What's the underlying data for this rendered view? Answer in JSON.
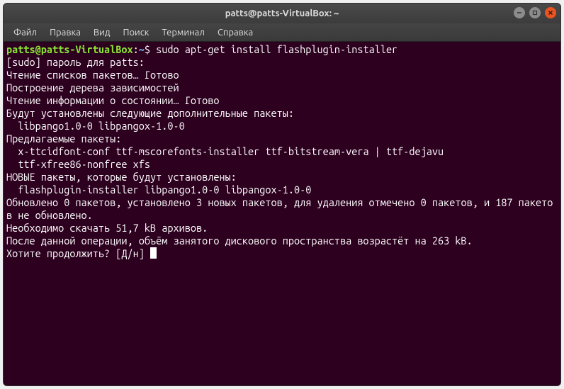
{
  "titlebar": {
    "title": "patts@patts-VirtualBox: ~"
  },
  "menubar": {
    "items": [
      "Файл",
      "Правка",
      "Вид",
      "Поиск",
      "Терминал",
      "Справка"
    ]
  },
  "terminal": {
    "prompt_user_host": "patts@patts-VirtualBox",
    "prompt_colon": ":",
    "prompt_path": "~",
    "prompt_dollar": "$ ",
    "command": "sudo apt-get install flashplugin-installer",
    "output_lines": [
      "[sudo] пароль для patts:",
      "Чтение списков пакетов… Готово",
      "Построение дерева зависимостей",
      "Чтение информации о состоянии… Готово",
      "Будут установлены следующие дополнительные пакеты:",
      "  libpango1.0-0 libpangox-1.0-0",
      "Предлагаемые пакеты:",
      "  x-ttcidfont-conf ttf-mscorefonts-installer ttf-bitstream-vera | ttf-dejavu",
      "  ttf-xfree86-nonfree xfs",
      "НОВЫЕ пакеты, которые будут установлены:",
      "  flashplugin-installer libpango1.0-0 libpangox-1.0-0",
      "Обновлено 0 пакетов, установлено 3 новых пакетов, для удаления отмечено 0 пакетов, и 187 пакетов не обновлено.",
      "Необходимо скачать 51,7 kB архивов.",
      "После данной операции, объём занятого дискового пространства возрастёт на 263 kB.",
      "Хотите продолжить? [Д/н] "
    ]
  }
}
